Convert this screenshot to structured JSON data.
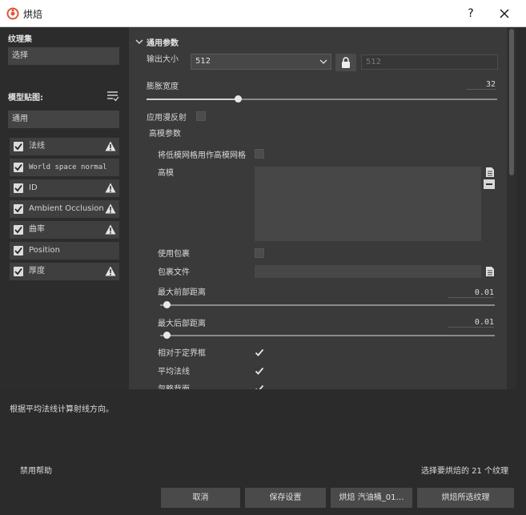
{
  "window": {
    "title": "烘焙",
    "help_glyph": "?",
    "accent_color": "#e0533a"
  },
  "left_panel": {
    "texture_set_label": "纹理集",
    "texture_set_value": "选择",
    "model_maps_label": "模型贴图:",
    "common_field": "通用",
    "maps": [
      {
        "label": "法线",
        "checked": true,
        "warning": true,
        "mono": false
      },
      {
        "label": "World space normal",
        "checked": true,
        "warning": false,
        "mono": true
      },
      {
        "label": "ID",
        "checked": true,
        "warning": true,
        "mono": false
      },
      {
        "label": "Ambient Occlusion",
        "checked": true,
        "warning": true,
        "mono": false
      },
      {
        "label": "曲率",
        "checked": true,
        "warning": true,
        "mono": false
      },
      {
        "label": "Position",
        "checked": true,
        "warning": false,
        "mono": false
      },
      {
        "label": "厚度",
        "checked": true,
        "warning": true,
        "mono": false
      }
    ]
  },
  "params": {
    "section_title": "通用参数",
    "output_size_label": "输出大小",
    "output_size_value": "512",
    "output_size_linked_value": "512",
    "dilation_label": "膨胀宽度",
    "dilation_value": "32",
    "dilation_fraction": 0.26,
    "apply_diffusion_label": "应用漫反射",
    "apply_diffusion_checked": false,
    "high_poly_section": "高模参数",
    "use_low_as_high_label": "将低模网格用作高模网格",
    "use_low_as_high_checked": false,
    "high_poly_label": "高模",
    "use_cage_label": "使用包裹",
    "use_cage_checked": false,
    "cage_file_label": "包裹文件",
    "max_front_label": "最大前部距离",
    "max_front_value": "0.01",
    "max_front_fraction": 0.02,
    "max_rear_label": "最大后部距离",
    "max_rear_value": "0.01",
    "max_rear_fraction": 0.02,
    "relative_bbox_label": "相对于定界框",
    "relative_bbox_checked": true,
    "average_normals_label": "平均法线",
    "average_normals_checked": true,
    "ignore_backface_label": "忽略背面",
    "ignore_backface_checked": true
  },
  "help": {
    "description": "根据平均法线计算射线方向。",
    "disable_help": "禁用帮助",
    "selection_summary": "选择要烘焙的 21 个纹理"
  },
  "buttons": {
    "cancel": "取消",
    "save_settings": "保存设置",
    "bake_current": "烘焙 汽油桶_01…",
    "bake_selected": "烘焙所选纹理"
  }
}
